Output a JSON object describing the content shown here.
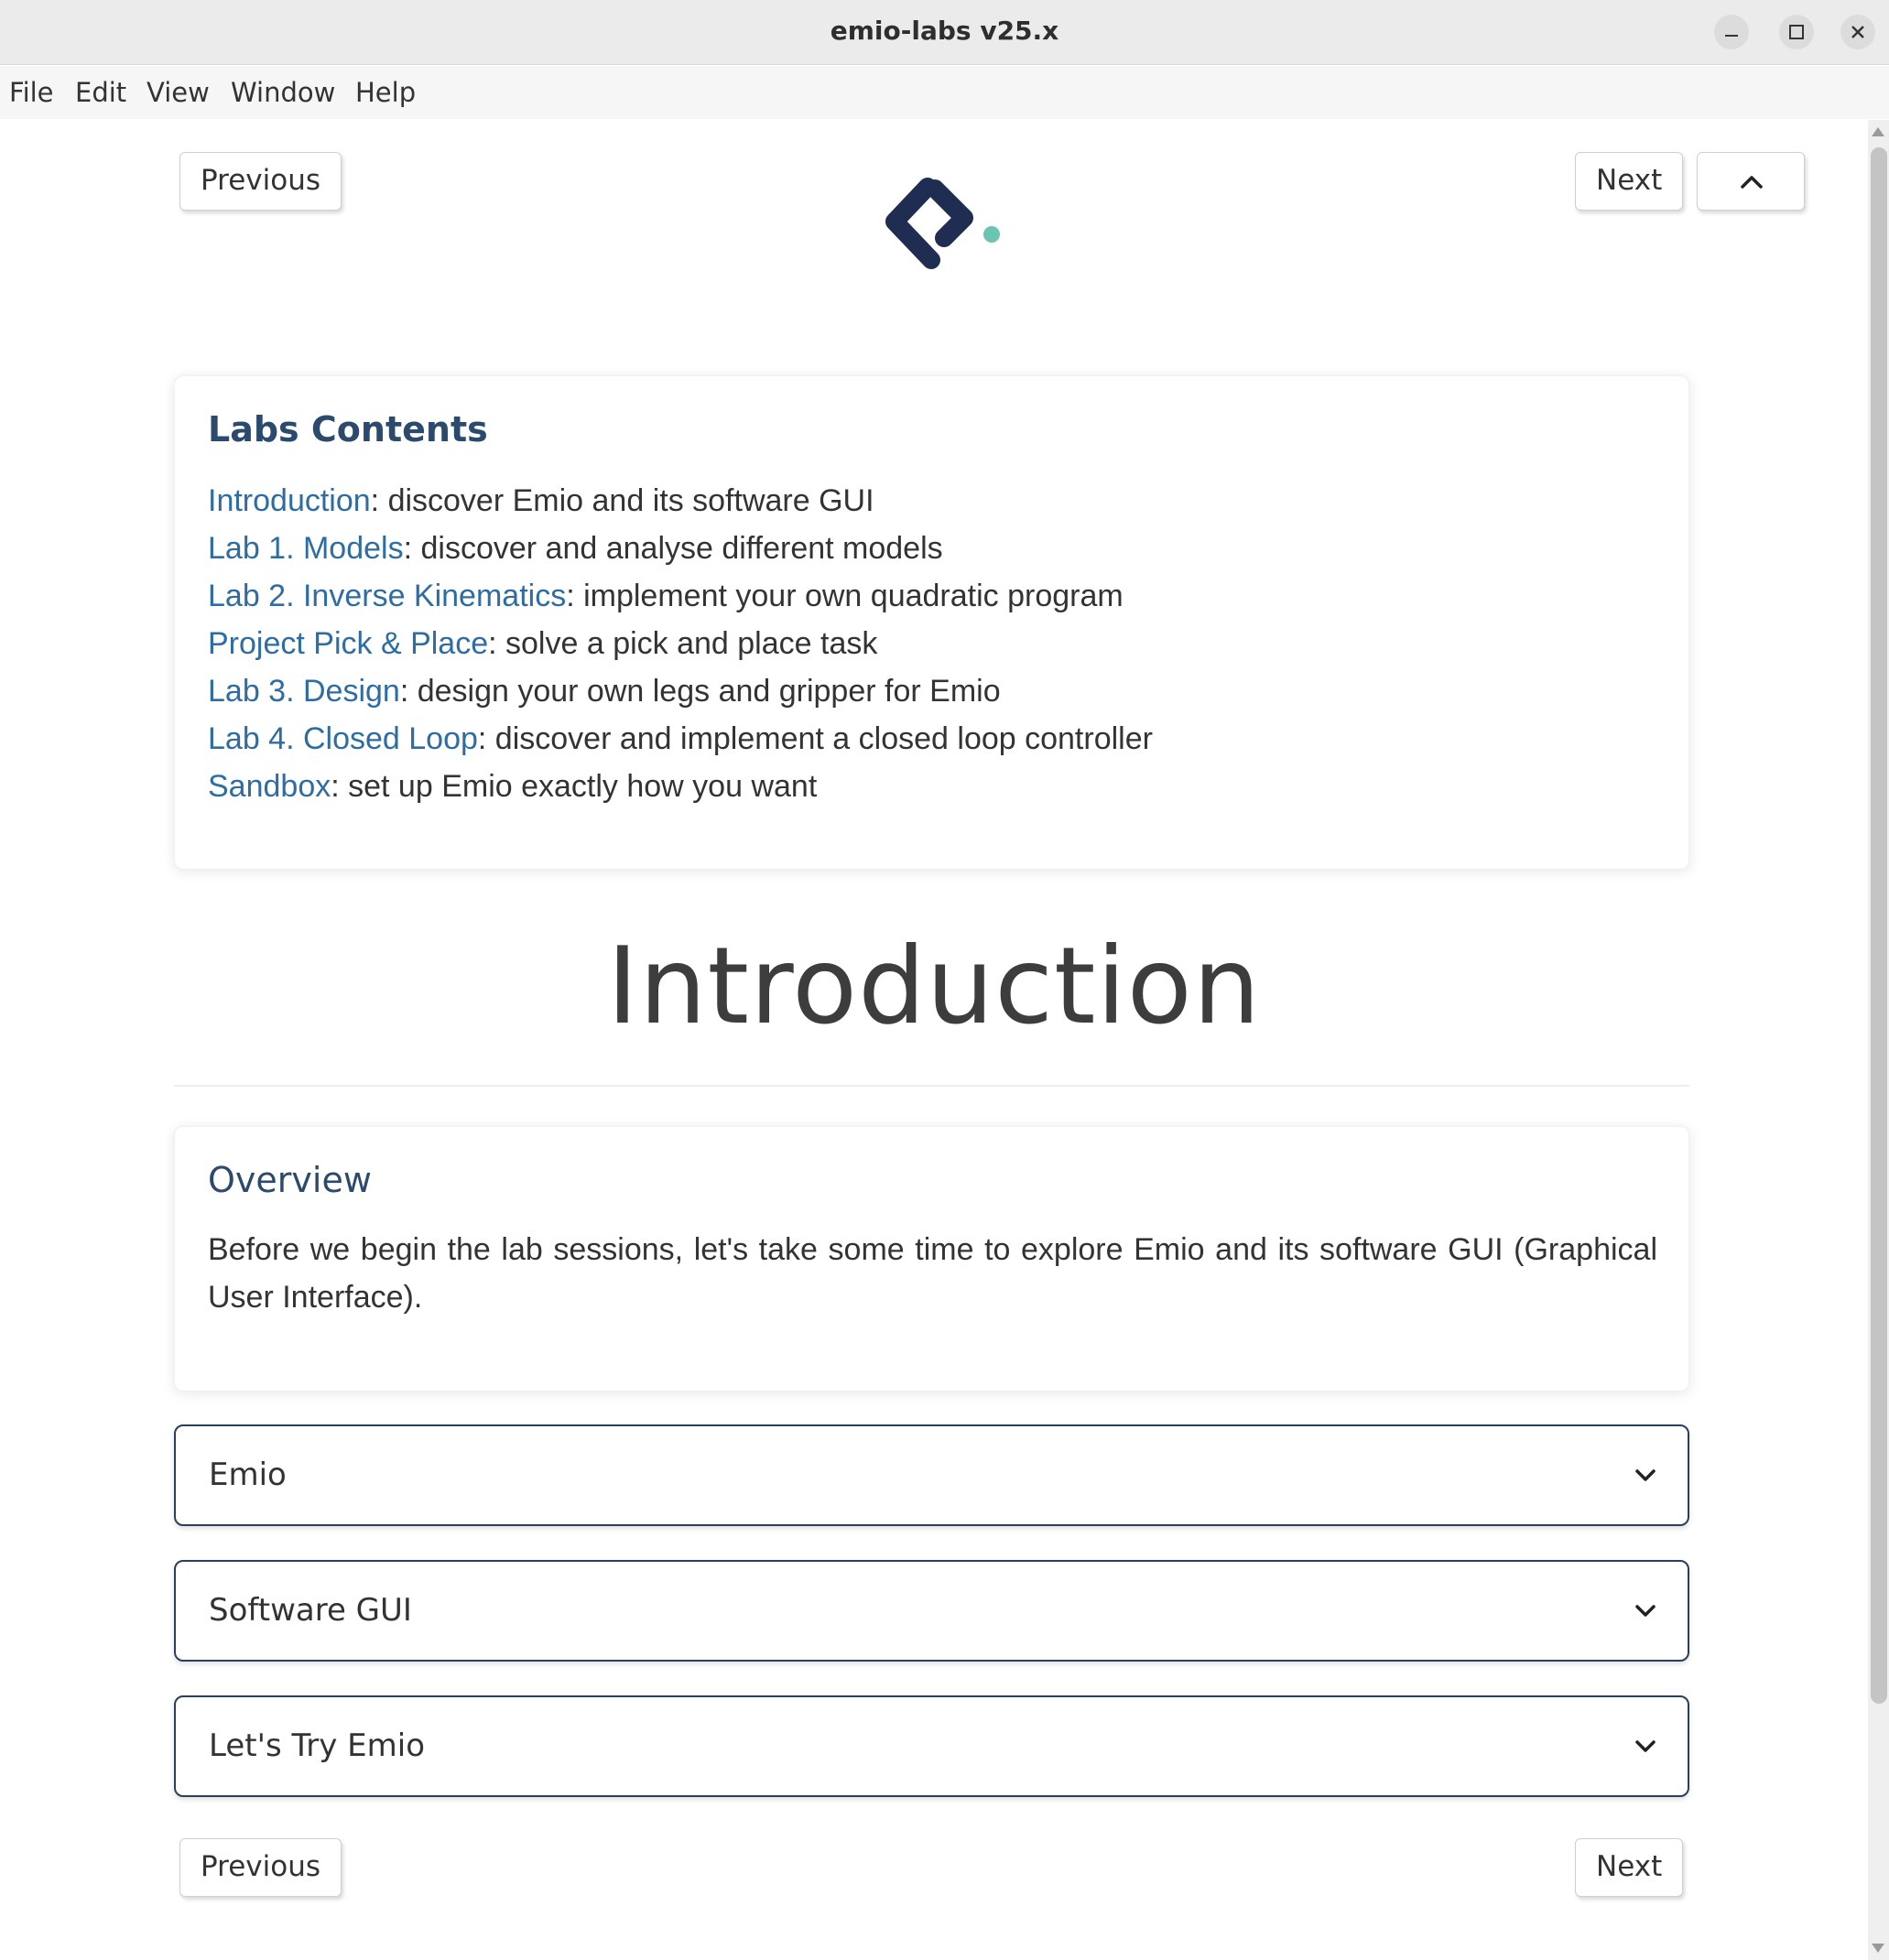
{
  "window": {
    "title": "emio-labs v25.x"
  },
  "menu": [
    "File",
    "Edit",
    "View",
    "Window",
    "Help"
  ],
  "nav": {
    "previous": "Previous",
    "next": "Next"
  },
  "logo": {
    "name": "emio-logo",
    "colors": {
      "primary": "#1f2d52",
      "dot": "#6cc4b3"
    }
  },
  "contents": {
    "heading": "Labs Contents",
    "items": [
      {
        "link": "Introduction",
        "desc": ": discover Emio and its software GUI"
      },
      {
        "link": "Lab 1. Models",
        "desc": ": discover and analyse different models"
      },
      {
        "link": "Lab 2. Inverse Kinematics",
        "desc": ": implement your own quadratic program"
      },
      {
        "link": "Project Pick & Place",
        "desc": ": solve a pick and place task"
      },
      {
        "link": "Lab 3. Design",
        "desc": ": design your own legs and gripper for Emio"
      },
      {
        "link": "Lab 4. Closed Loop",
        "desc": ": discover and implement a closed loop controller"
      },
      {
        "link": "Sandbox",
        "desc": ": set up Emio exactly how you want"
      }
    ]
  },
  "page_title": "Introduction",
  "overview": {
    "heading": "Overview",
    "text": "Before we begin the lab sessions, let's take some time to explore Emio and its software GUI (Graphical User Interface)."
  },
  "sections": [
    "Emio",
    "Software GUI",
    "Let's Try Emio"
  ],
  "colors": {
    "link": "#2e6da4",
    "heading": "#2c4a6e",
    "accordion_border": "#2a3f5c"
  }
}
